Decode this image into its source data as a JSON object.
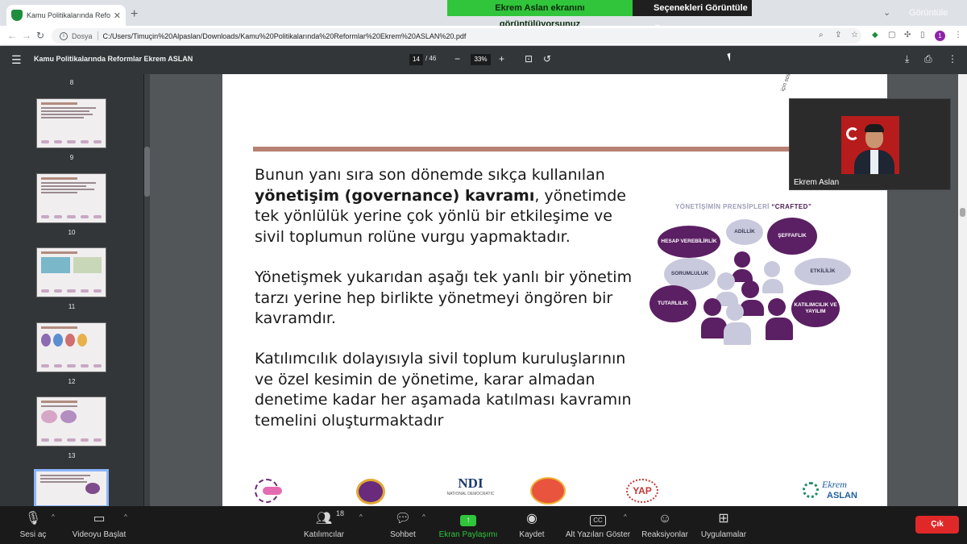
{
  "browser": {
    "tab_title": "Kamu Politikalarında Reformlar E",
    "address_label": "Dosya",
    "url": "C:/Users/Timuçin%20Alpaslan/Downloads/Kamu%20Politikalarında%20Reformlar%20Ekrem%20ASLAN%20.pdf",
    "profile_initial": "1"
  },
  "zoom_share": {
    "message": "Ekrem Aslan ekranını görüntülüyorsunuz",
    "options_label": "Seçenekleri Görüntüle",
    "ghost_label": "Görüntüle"
  },
  "pdf": {
    "title": "Kamu Politikalarında Reformlar Ekrem ASLAN",
    "page_current": "14",
    "page_total": "/ 46",
    "zoom": "33%"
  },
  "sidebar": {
    "pages": [
      "8",
      "9",
      "10",
      "11",
      "12",
      "13"
    ]
  },
  "slide": {
    "paragraph1_a": "Bunun yanı sıra son dönemde sıkça kullanılan",
    "paragraph1_bold": "yönetişim (governance) kavramı",
    "paragraph1_b": ", yönetimde tek yönlülük yerine çok yönlü bir etkileşime ve sivil toplumun rolüne vurgu yapmaktadır.",
    "paragraph2": "Yönetişmek yukarıdan aşağı tek yanlı bir yönetim tarzı yerine hep birlikte yönetmeyi öngören bir kavramdır.",
    "paragraph3": "Katılımcılık dolayısıyla sivil toplum kuruluşlarının ve özel kesimin de yönetime, karar almadan denetime kadar her aşamada katılması kavramın temelini oluşturmaktadır",
    "stamp_text": "için sosyal",
    "diagram_title": "YÖNETİŞİMİN PRENSİPLERİ",
    "diagram_title_accent": "“CRAFTED”",
    "principles": {
      "hesap": "HESAP VEREBİLİRLİK",
      "adillik": "ADİLLİK",
      "seffaflik": "ŞEFFAFLIK",
      "sorumluluk": "SORUMLULUK",
      "etkililik": "ETKİLİLİK",
      "tutarlilik": "TUTARLILIK",
      "katilimcilik": "KATILIMCILIK VE YAYILIM"
    },
    "logos": {
      "ndi": "NDI",
      "ndi_sub": "NATIONAL DEMOCRATIC",
      "yap": "YAP",
      "ekrem_top": "Ekrem",
      "ekrem_bottom": "ASLAN"
    }
  },
  "video": {
    "name": "Ekrem Aslan"
  },
  "zoom_bar": {
    "mute": "Sesi aç",
    "video": "Videoyu Başlat",
    "participants": "Katılımcılar",
    "participants_count": "18",
    "chat": "Sohbet",
    "share": "Ekran Paylaşımı",
    "record": "Kaydet",
    "captions": "Alt Yazıları Göster",
    "captions_badge": "CC",
    "reactions": "Reaksiyonlar",
    "apps": "Uygulamalar",
    "leave": "Çık"
  },
  "colors": {
    "accent_green": "#30c53b",
    "leave_red": "#e02828",
    "purple_dark": "#5b1f63",
    "lavender": "#c9c9dd",
    "rule": "#b88173"
  }
}
